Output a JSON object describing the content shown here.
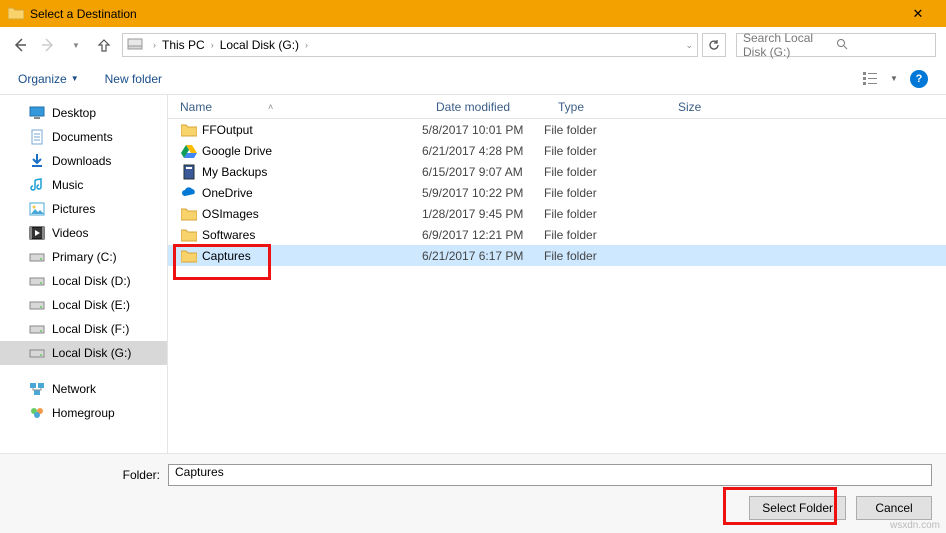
{
  "title": "Select a Destination",
  "breadcrumb": {
    "root": "This PC",
    "drive": "Local Disk (G:)"
  },
  "search": {
    "placeholder": "Search Local Disk (G:)"
  },
  "toolbar": {
    "organize": "Organize",
    "newfolder": "New folder"
  },
  "sidebar": {
    "items": [
      {
        "label": "Desktop",
        "icon": "desktop"
      },
      {
        "label": "Documents",
        "icon": "doc"
      },
      {
        "label": "Downloads",
        "icon": "download"
      },
      {
        "label": "Music",
        "icon": "music"
      },
      {
        "label": "Pictures",
        "icon": "pictures"
      },
      {
        "label": "Videos",
        "icon": "videos"
      },
      {
        "label": "Primary (C:)",
        "icon": "drive"
      },
      {
        "label": "Local Disk (D:)",
        "icon": "drive"
      },
      {
        "label": "Local Disk (E:)",
        "icon": "drive"
      },
      {
        "label": "Local Disk (F:)",
        "icon": "drive"
      },
      {
        "label": "Local Disk (G:)",
        "icon": "drive",
        "selected": true
      }
    ],
    "items2": [
      {
        "label": "Network",
        "icon": "network"
      },
      {
        "label": "Homegroup",
        "icon": "homegroup"
      }
    ]
  },
  "columns": {
    "name": "Name",
    "date": "Date modified",
    "type": "Type",
    "size": "Size"
  },
  "rows": [
    {
      "name": "FFOutput",
      "date": "5/8/2017 10:01 PM",
      "type": "File folder",
      "icon": "folder"
    },
    {
      "name": "Google Drive",
      "date": "6/21/2017 4:28 PM",
      "type": "File folder",
      "icon": "gdrive"
    },
    {
      "name": "My Backups",
      "date": "6/15/2017 9:07 AM",
      "type": "File folder",
      "icon": "backup"
    },
    {
      "name": "OneDrive",
      "date": "5/9/2017 10:22 PM",
      "type": "File folder",
      "icon": "onedrive"
    },
    {
      "name": "OSImages",
      "date": "1/28/2017 9:45 PM",
      "type": "File folder",
      "icon": "folder"
    },
    {
      "name": "Softwares",
      "date": "6/9/2017 12:21 PM",
      "type": "File folder",
      "icon": "folder"
    },
    {
      "name": "Captures",
      "date": "6/21/2017 6:17 PM",
      "type": "File folder",
      "icon": "folder",
      "selected": true
    }
  ],
  "footer": {
    "label": "Folder:",
    "value": "Captures",
    "select": "Select Folder",
    "cancel": "Cancel"
  },
  "watermark": "wsxdn.com"
}
